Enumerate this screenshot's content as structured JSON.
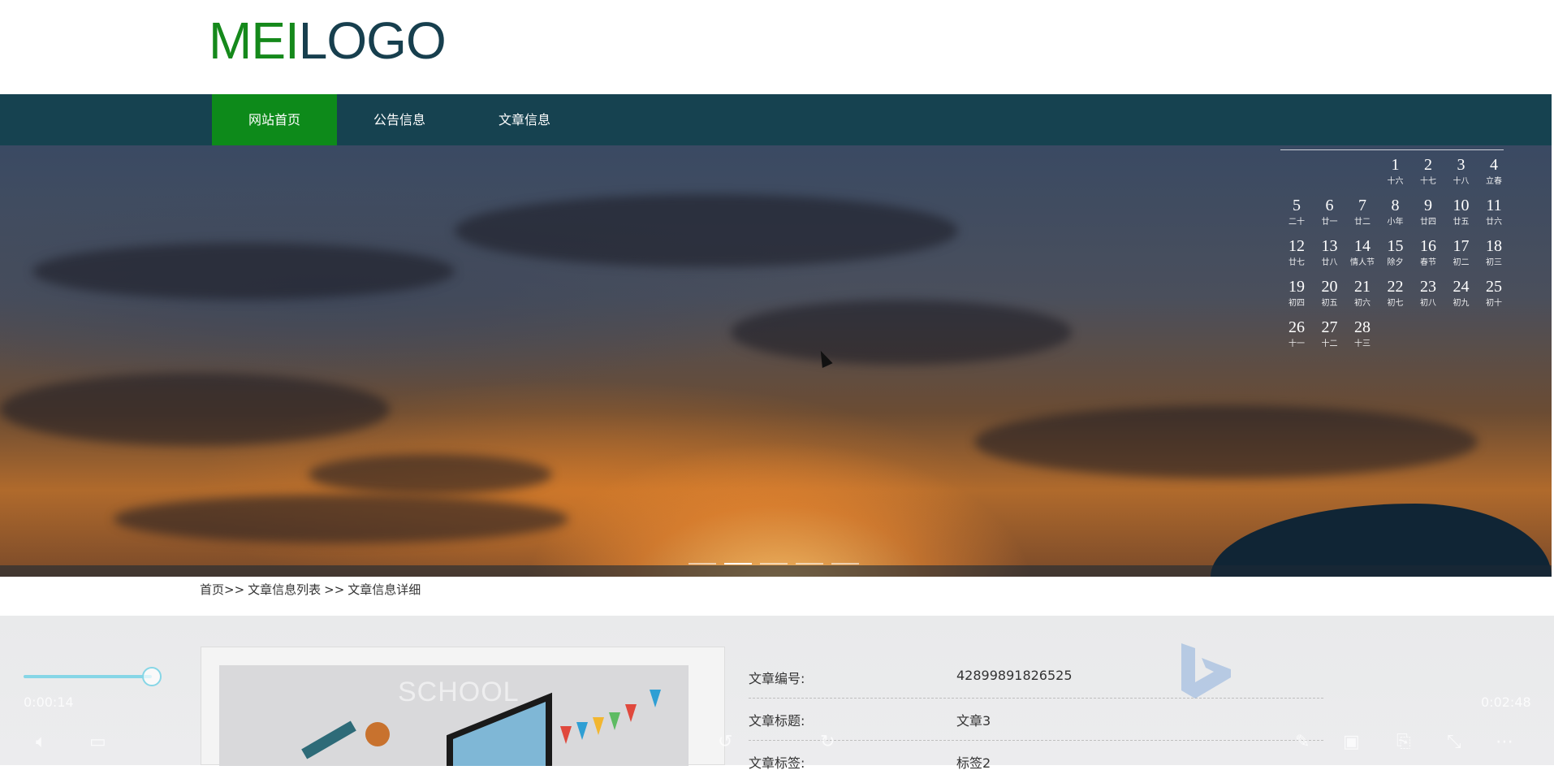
{
  "logo": {
    "part1": "MEI",
    "part2": "LOGO",
    "color1": "#15891b",
    "color2": "#173f4e"
  },
  "nav": {
    "items": [
      {
        "label": "网站首页",
        "active": true
      },
      {
        "label": "公告信息",
        "active": false
      },
      {
        "label": "文章信息",
        "active": false
      }
    ],
    "bg_color": "#164250",
    "active_color": "#0d8a1a"
  },
  "calendar": {
    "days": [
      {
        "day": "1",
        "lunar": "十六"
      },
      {
        "day": "2",
        "lunar": "十七"
      },
      {
        "day": "3",
        "lunar": "十八"
      },
      {
        "day": "4",
        "lunar": "立春"
      },
      {
        "day": "5",
        "lunar": "二十"
      },
      {
        "day": "6",
        "lunar": "廿一"
      },
      {
        "day": "7",
        "lunar": "廿二"
      },
      {
        "day": "8",
        "lunar": "小年"
      },
      {
        "day": "9",
        "lunar": "廿四"
      },
      {
        "day": "10",
        "lunar": "廿五"
      },
      {
        "day": "11",
        "lunar": "廿六"
      },
      {
        "day": "12",
        "lunar": "廿七"
      },
      {
        "day": "13",
        "lunar": "廿八"
      },
      {
        "day": "14",
        "lunar": "情人节"
      },
      {
        "day": "15",
        "lunar": "除夕"
      },
      {
        "day": "16",
        "lunar": "春节"
      },
      {
        "day": "17",
        "lunar": "初二"
      },
      {
        "day": "18",
        "lunar": "初三"
      },
      {
        "day": "19",
        "lunar": "初四"
      },
      {
        "day": "20",
        "lunar": "初五"
      },
      {
        "day": "21",
        "lunar": "初六"
      },
      {
        "day": "22",
        "lunar": "初七"
      },
      {
        "day": "23",
        "lunar": "初八"
      },
      {
        "day": "24",
        "lunar": "初九"
      },
      {
        "day": "25",
        "lunar": "初十"
      },
      {
        "day": "26",
        "lunar": "十一"
      },
      {
        "day": "27",
        "lunar": "十二"
      },
      {
        "day": "28",
        "lunar": "十三"
      }
    ]
  },
  "banner": {
    "slide_count": 5,
    "active_slide": 2
  },
  "breadcrumb": {
    "items": [
      "首页>>",
      "文章信息列表",
      ">>",
      "文章信息详细"
    ]
  },
  "article": {
    "image_text": "SCHOOL",
    "fields": [
      {
        "label": "文章编号:",
        "value": "42899891826525"
      },
      {
        "label": "文章标题:",
        "value": "文章3"
      },
      {
        "label": "文章标签:",
        "value": "标签2"
      }
    ]
  },
  "player": {
    "current_time": "0:00:14",
    "total_time": "0:02:48",
    "progress": 0.88,
    "accent_color": "#86d6e6"
  }
}
